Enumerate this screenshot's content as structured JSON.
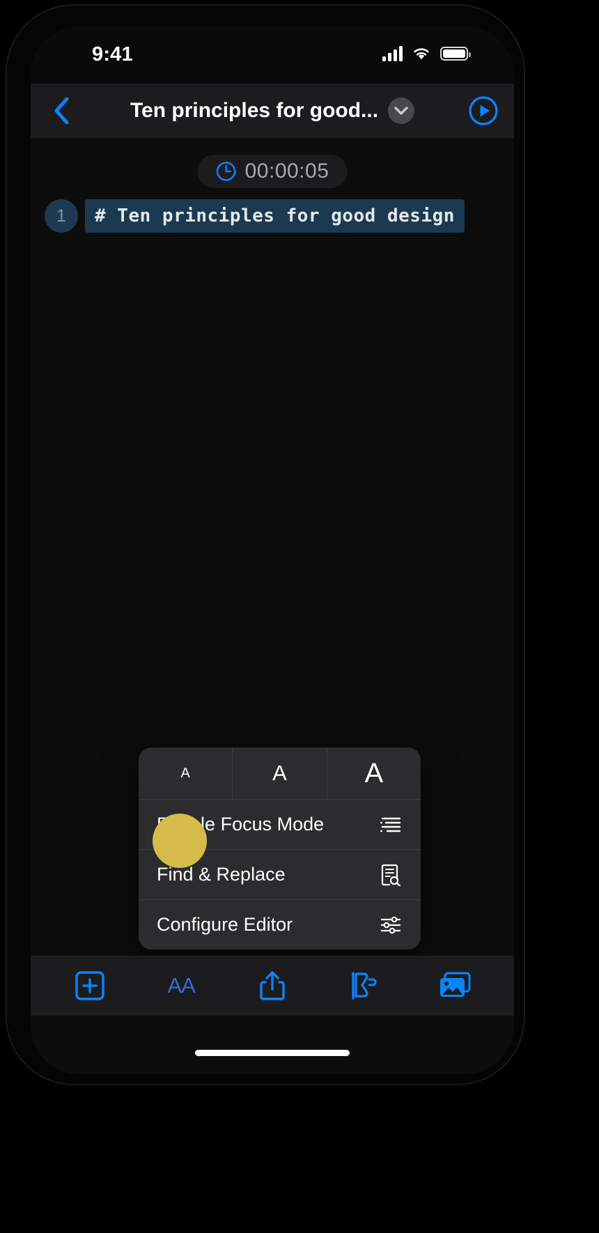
{
  "status_bar": {
    "time": "9:41",
    "cellular_icon": "signal-bars-icon",
    "wifi_icon": "wifi-icon",
    "battery_icon": "battery-full-icon"
  },
  "nav_bar": {
    "back_icon": "chevron-left-icon",
    "title": "Ten principles for good...",
    "dropdown_icon": "chevron-down-icon",
    "play_icon": "play-circle-icon",
    "accent_color": "#0a84ff"
  },
  "editor": {
    "timer": {
      "icon": "clock-icon",
      "value": "00:00:05"
    },
    "lines": [
      {
        "number": "1",
        "text": "# Ten principles for good design"
      }
    ],
    "highlight_color": "#1b3a52"
  },
  "popup_menu": {
    "font_sizes": [
      {
        "label": "A",
        "size": "small"
      },
      {
        "label": "A",
        "size": "medium"
      },
      {
        "label": "A",
        "size": "large"
      }
    ],
    "items": [
      {
        "label": "Enable Focus Mode",
        "icon": "text-align-focus-icon"
      },
      {
        "label": "Find & Replace",
        "icon": "document-search-icon"
      },
      {
        "label": "Configure Editor",
        "icon": "sliders-icon"
      }
    ]
  },
  "tap_indicator": {
    "color": "#d4bb4a",
    "target": "Enable Focus Mode"
  },
  "toolbar": {
    "accent_color": "#0a84ff",
    "items": [
      {
        "name": "insert-button",
        "icon": "plus-square-icon",
        "label": ""
      },
      {
        "name": "text-style-button",
        "icon": "text-size-icon",
        "label": "AA"
      },
      {
        "name": "share-button",
        "icon": "share-icon",
        "label": ""
      },
      {
        "name": "theme-button",
        "icon": "palette-icon",
        "label": ""
      },
      {
        "name": "media-button",
        "icon": "photos-icon",
        "label": ""
      }
    ]
  },
  "home_indicator": "home-bar"
}
